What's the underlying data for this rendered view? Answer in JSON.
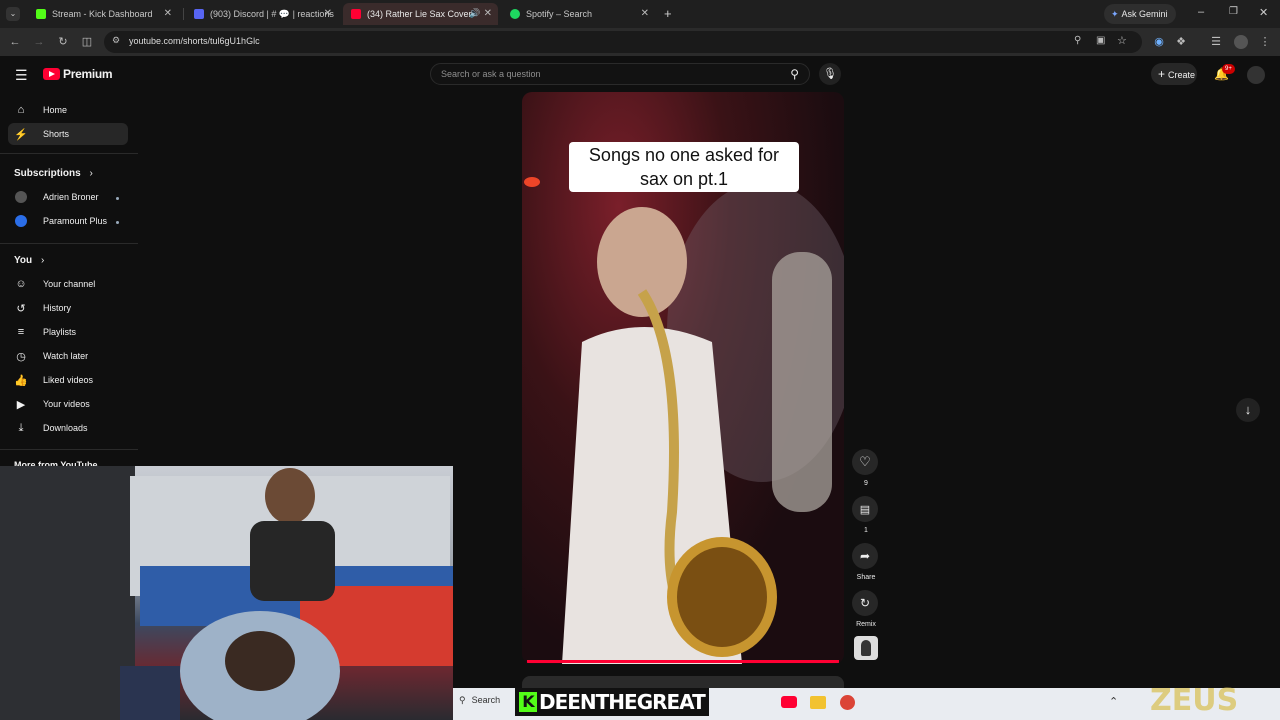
{
  "tabs": [
    {
      "label": "Stream - Kick Dashboard",
      "color": "#53fc18"
    },
    {
      "label": "(903) Discord | # 💬 | reactions",
      "color": "#5865f2"
    },
    {
      "label": "(34) Rather Lie Sax Cover -",
      "color": "#ff0033"
    },
    {
      "label": "Spotify – Search",
      "color": "#1ed760"
    }
  ],
  "ask_gemini": "Ask Gemini",
  "url": "youtube.com/shorts/tul6gU1hGlc",
  "header": {
    "logo_text": "Premium",
    "search_placeholder": "Search or ask a question",
    "create_label": "Create",
    "notif_count": "9+"
  },
  "sidebar": {
    "main": [
      {
        "label": "Home",
        "icon": "home-icon"
      },
      {
        "label": "Shorts",
        "icon": "shorts-icon"
      }
    ],
    "subscriptions_title": "Subscriptions",
    "subscriptions": [
      {
        "label": "Adrien Broner"
      },
      {
        "label": "Paramount Plus"
      }
    ],
    "you_title": "You",
    "you_items": [
      {
        "label": "Your channel",
        "icon": "person-icon"
      },
      {
        "label": "History",
        "icon": "history-icon"
      },
      {
        "label": "Playlists",
        "icon": "playlist-icon"
      },
      {
        "label": "Watch later",
        "icon": "clock-icon"
      },
      {
        "label": "Liked videos",
        "icon": "thumb-icon"
      },
      {
        "label": "Your videos",
        "icon": "video-icon"
      },
      {
        "label": "Downloads",
        "icon": "download-icon"
      }
    ],
    "more_title": "More from YouTube"
  },
  "short": {
    "caption_line1": "Songs no one asked for",
    "caption_line2": "sax on pt.1",
    "likes": "9",
    "comments": "1",
    "share_label": "Share",
    "remix_label": "Remix"
  },
  "overlay": {
    "streamer_name": "DEENTHEGREAT",
    "watermark": "ZEUS",
    "taskbar_search": "Search"
  }
}
